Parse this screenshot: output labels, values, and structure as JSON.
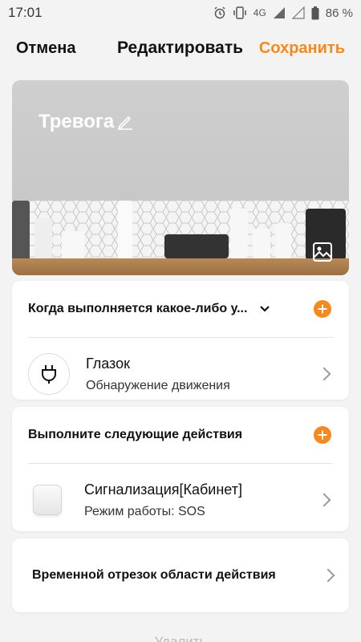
{
  "status_bar": {
    "time": "17:01",
    "network": "4G",
    "battery": "86 %"
  },
  "header": {
    "cancel": "Отмена",
    "title": "Редактировать",
    "save": "Сохранить"
  },
  "cover": {
    "title": "Тревога"
  },
  "condition": {
    "heading": "Когда выполняется какое-либо у...",
    "item": {
      "title": "Глазок",
      "subtitle": "Обнаружение движения",
      "icon": "plug-icon"
    }
  },
  "actions": {
    "heading": "Выполните следующие действия",
    "item": {
      "title": "Сигнализация[Кабинет]",
      "subtitle": "Режим работы: SOS"
    }
  },
  "time_range": {
    "label": "Временной отрезок области действия"
  },
  "delete": {
    "label": "Удалить"
  },
  "colors": {
    "accent": "#f5891f",
    "background": "#f3f3f3",
    "card": "#ffffff"
  }
}
